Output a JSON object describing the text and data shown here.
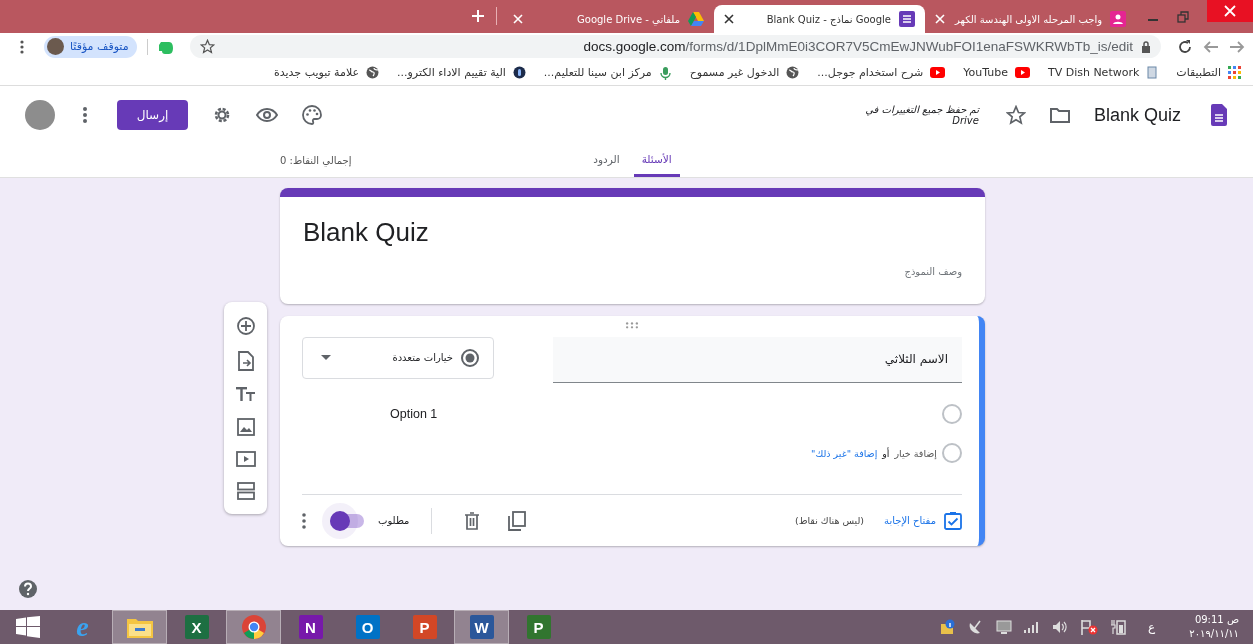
{
  "browser": {
    "tabs": [
      {
        "title": "واجب المرحله الاولى الهندسة الكهر",
        "selected": false
      },
      {
        "title": "Blank Quiz - نماذج Google",
        "selected": true
      },
      {
        "title": "Google Drive - ملفاتي",
        "selected": false
      }
    ],
    "profile_chip": "متوقف مؤقتًا",
    "url": {
      "host": "docs.google.com",
      "path": "/forms/d/1DplMmE0i3COR7V5CmEwJNWubFOI1enaFSWKRWbTb_is/edit"
    },
    "bookmarks": [
      {
        "label": "التطبيقات"
      },
      {
        "label": "TV Dish Network"
      },
      {
        "label": "YouTube"
      },
      {
        "label": "شرح استخدام جوجل..."
      },
      {
        "label": "الدخول غير مسموح"
      },
      {
        "label": "مركز ابن سينا للتعليم..."
      },
      {
        "label": "الية تقييم الاداء الكترو..."
      },
      {
        "label": "علامة تبويب جديدة"
      }
    ]
  },
  "form_header": {
    "title": "Blank Quiz",
    "save_status": [
      "تم حفظ جميع التغييرات في",
      "Drive"
    ],
    "send_button": "إرسال"
  },
  "form_tabs": [
    {
      "label": "الأسئلة",
      "selected": true
    },
    {
      "label": "الردود",
      "selected": false
    }
  ],
  "total_points": "إجمالي النقاط: 0",
  "title_card": {
    "title": "Blank Quiz",
    "description_placeholder": "وصف النموذج"
  },
  "question": {
    "title": "الاسم الثلاثي",
    "type": "خيارات متعددة",
    "options": [
      {
        "label": "Option 1",
        "selected": false
      }
    ],
    "add_option": "إضافة خيار",
    "or": "أو",
    "add_other": "إضافة \"غير ذلك\"",
    "answer_key": "مفتاح الإجابة",
    "points": "(ليس هناك نقاط)",
    "required_label": "مطلوب",
    "required": true
  },
  "taskbar": {
    "apps": [
      {
        "glyph": "P",
        "selected": false
      },
      {
        "glyph": "W",
        "selected": true
      },
      {
        "glyph": "P",
        "selected": false
      },
      {
        "glyph": "O",
        "selected": false
      },
      {
        "glyph": "N",
        "selected": false
      },
      {
        "selected": true
      },
      {
        "glyph": "X",
        "selected": false
      },
      {
        "selected": true
      },
      {
        "glyph": "e",
        "selected": false
      }
    ],
    "language": "ع",
    "time": "ص 09:11",
    "date": "٢٠١٩/١١/١١"
  }
}
